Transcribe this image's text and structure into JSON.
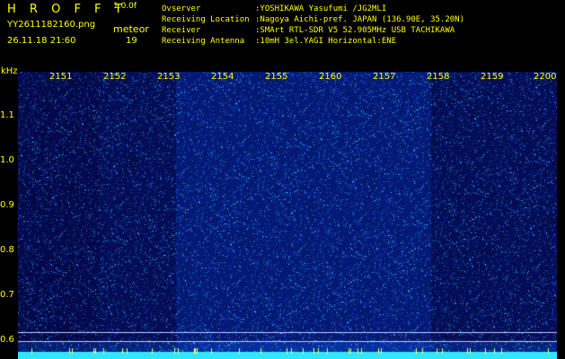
{
  "header": {
    "logo": "H R O F F T",
    "version": "1.0.0f",
    "filename": "YY2611182160.png",
    "meteor_label": "meteor",
    "timestamp": "26.11.18 21:60",
    "meteor_count": "19"
  },
  "info": [
    {
      "key": "Ovserver",
      "value": ":YOSHIKAWA Yasufumi /JG2MLI"
    },
    {
      "key": "Receiving Location",
      "value": ":Nagoya Aichi-pref. JAPAN (136.90E, 35.20N)"
    },
    {
      "key": "Receiver",
      "value": ":SMArt RTL-SDR V5 52.905MHz USB TACHIKAWA"
    },
    {
      "key": "Receiving Antenna",
      "value": ":10mH 3el.YAGI Horizontal:ENE"
    }
  ],
  "axis": {
    "y_unit": "kHz",
    "y_ticks": [
      "1.1",
      "1.0",
      "0.9",
      "0.8",
      "0.7",
      "0.6"
    ],
    "x_ticks": [
      "2151",
      "2152",
      "2153",
      "2154",
      "2155",
      "2160",
      "2157",
      "2158",
      "2159",
      "2200"
    ]
  },
  "colors": {
    "text": "#ffff00",
    "background": "#000000",
    "spectrum_base": "#0a1a8c",
    "noise_floor": "#33e6ff"
  }
}
